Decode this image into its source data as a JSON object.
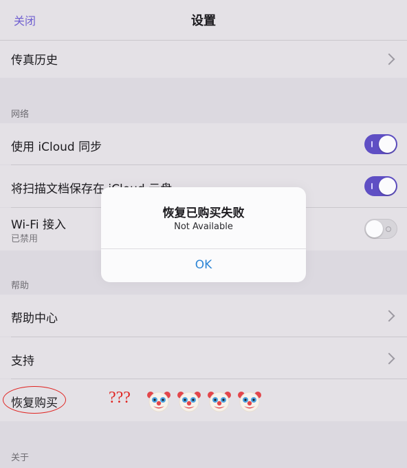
{
  "nav": {
    "close_label": "关闭",
    "title": "设置"
  },
  "rows": {
    "fax_history": "传真历史",
    "use_icloud_sync": "使用 iCloud 同步",
    "save_scans_icloud": "将扫描文档保存在 iCloud 云盘",
    "wifi_access": "Wi-Fi 接入",
    "wifi_status": "已禁用",
    "help_center": "帮助中心",
    "support": "支持",
    "restore_purchase": "恢复购买"
  },
  "toggles": {
    "use_icloud_sync": true,
    "save_scans_icloud": true,
    "wifi_access": false
  },
  "sections": {
    "network": "网络",
    "help": "帮助",
    "about": "关于"
  },
  "dialog": {
    "title": "恢复已购买失败",
    "message": "Not Available",
    "ok_label": "OK"
  },
  "annotation": {
    "text": "???",
    "emoji": [
      "clown-face-icon",
      "clown-face-icon",
      "clown-face-icon",
      "clown-face-icon"
    ],
    "color": "#e0221f"
  },
  "colors": {
    "accent": "#5f4fc4",
    "link": "#2e86d6",
    "background": "#dcd9e0"
  }
}
